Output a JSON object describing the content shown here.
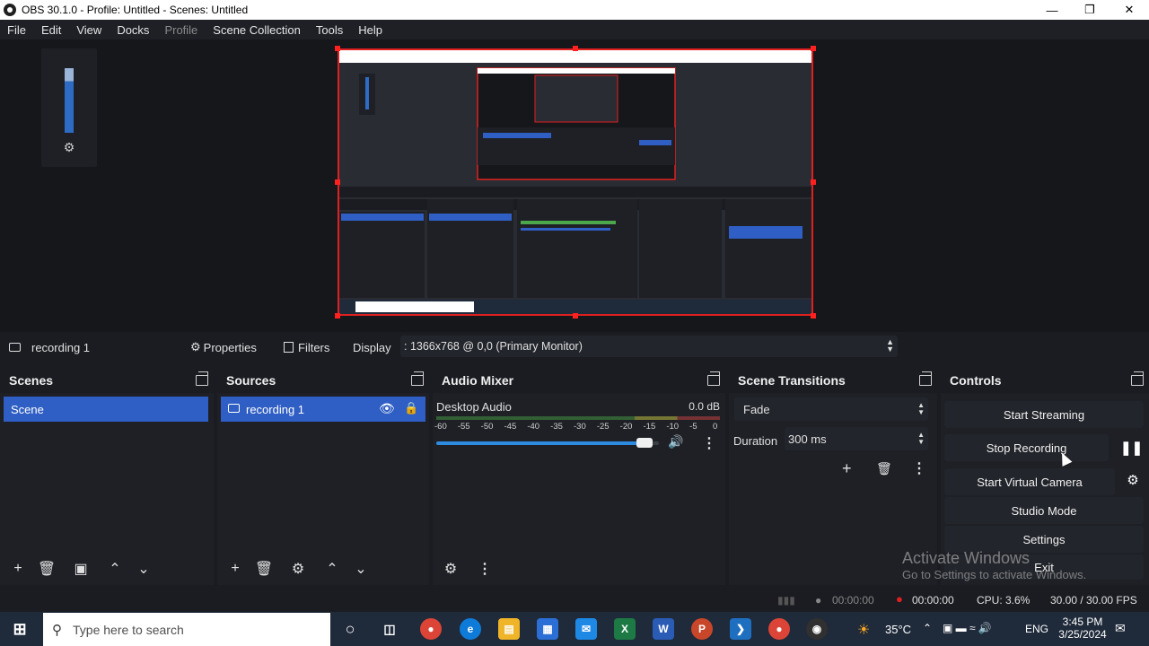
{
  "window": {
    "title": "OBS 30.1.0 - Profile: Untitled - Scenes: Untitled"
  },
  "menu": [
    "File",
    "Edit",
    "View",
    "Docks",
    "Profile",
    "Scene Collection",
    "Tools",
    "Help"
  ],
  "source_toolbar": {
    "source_name": "recording 1",
    "properties_label": "Properties",
    "filters_label": "Filters",
    "display_label": "Display",
    "display_value": ": 1366x768 @ 0,0 (Primary Monitor)"
  },
  "scenes": {
    "title": "Scenes",
    "items": [
      "Scene"
    ]
  },
  "sources": {
    "title": "Sources",
    "items": [
      "recording 1"
    ]
  },
  "audio_mixer": {
    "title": "Audio Mixer",
    "channel": "Desktop Audio",
    "level": "0.0 dB",
    "ticks": [
      "-60",
      "-55",
      "-50",
      "-45",
      "-40",
      "-35",
      "-30",
      "-25",
      "-20",
      "-15",
      "-10",
      "-5",
      "0"
    ],
    "volume_fraction": 0.97
  },
  "scene_transitions": {
    "title": "Scene Transitions",
    "transition": "Fade",
    "duration_label": "Duration",
    "duration_value": "300 ms"
  },
  "controls": {
    "title": "Controls",
    "start_streaming": "Start Streaming",
    "stop_recording": "Stop Recording",
    "start_virtual_camera": "Start Virtual Camera",
    "studio_mode": "Studio Mode",
    "settings": "Settings",
    "exit": "Exit"
  },
  "watermark": {
    "line1": "Activate Windows",
    "line2": "Go to Settings to activate Windows."
  },
  "status": {
    "stream_time": "00:00:00",
    "record_time": "00:00:00",
    "cpu": "CPU: 3.6%",
    "fps": "30.00 / 30.00 FPS"
  },
  "taskbar": {
    "search_placeholder": "Type here to search",
    "temperature": "35°C",
    "lang": "ENG",
    "time": "3:45 PM",
    "date": "3/25/2024"
  },
  "colors": {
    "accent": "#2f5ec4",
    "record_red": "#e02020"
  }
}
